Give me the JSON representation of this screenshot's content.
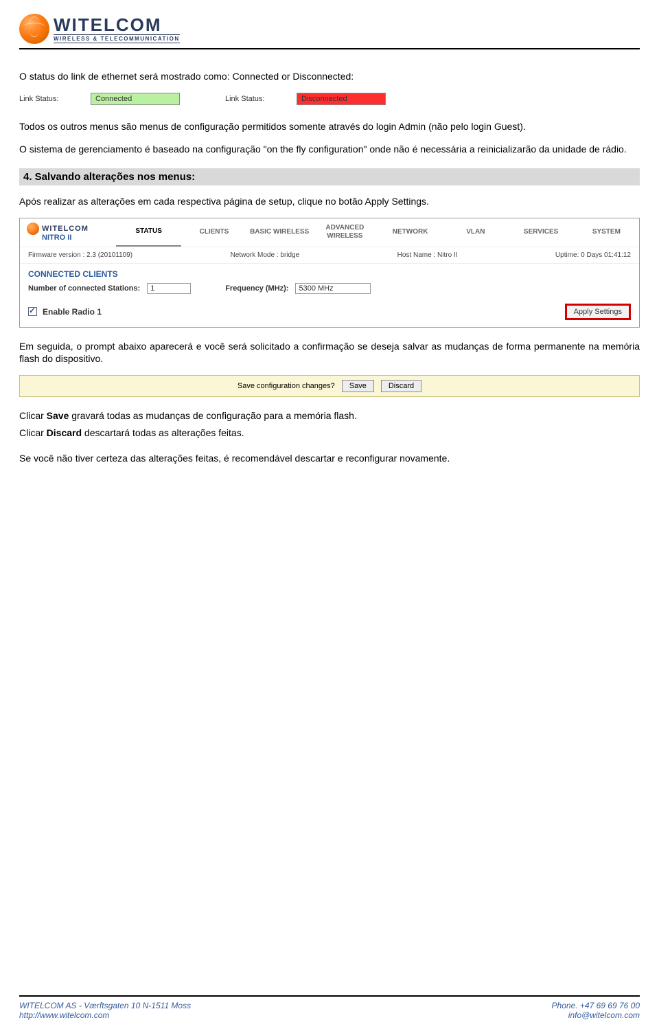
{
  "header": {
    "brand_main": "WITELCOM",
    "brand_sub": "WIRELESS & TELECOMMUNICATION"
  },
  "p1": "O status do link de ethernet será mostrado como: Connected or Disconnected:",
  "linkstatus": {
    "label1": "Link Status:",
    "val1": "Connected",
    "label2": "Link Status:",
    "val2": "Disconnected"
  },
  "p2": "Todos os outros menus são menus de configuração permitidos somente através do login Admin (não pelo login Guest).",
  "p3": "O sistema de gerenciamento é baseado na configuração \"on the fly configuration\" onde não é necessária a reinicializarão da unidade de rádio.",
  "section4": "4. Salvando alterações nos menus:",
  "p4": "Após realizar as alterações em cada respectiva página de setup, clique no botão Apply Settings.",
  "admin": {
    "brand": "WITELCOM",
    "model": "NITRO II",
    "tabs": [
      "STATUS",
      "CLIENTS",
      "BASIC WIRELESS",
      "ADVANCED WIRELESS",
      "NETWORK",
      "VLAN",
      "SERVICES",
      "SYSTEM"
    ],
    "active_tab": "STATUS",
    "info": {
      "fw_label": "Firmware version :",
      "fw_value": "2.3 (20101109)",
      "mode_label": "Network Mode :",
      "mode_value": "bridge",
      "host_label": "Host Name :",
      "host_value": "Nitro II",
      "uptime_label": "Uptime:",
      "uptime_value": "0 Days 01:41:12"
    },
    "cc_title": "CONNECTED CLIENTS",
    "cc_stations_label": "Number of connected Stations:",
    "cc_stations_value": "1",
    "cc_freq_label": "Frequency (MHz):",
    "cc_freq_value": "5300 MHz",
    "enable_label": "Enable Radio 1",
    "apply_label": "Apply Settings"
  },
  "p5": "Em seguida, o prompt abaixo aparecerá e você será solicitado a confirmação se deseja salvar as mudanças de forma permanente na memória flash do dispositivo.",
  "savebar": {
    "question": "Save configuration changes?",
    "save": "Save",
    "discard": "Discard"
  },
  "p6_prefix": "Clicar ",
  "p6_bold": "Save",
  "p6_suffix": " gravará todas as mudanças de configuração para a memória flash.",
  "p7_prefix": "Clicar ",
  "p7_bold": "Discard",
  "p7_suffix": " descartará todas as alterações feitas.",
  "p8": "Se você não tiver certeza das alterações feitas, é recomendável descartar e reconfigurar novamente.",
  "footer": {
    "left_line1": "WITELCOM AS - Værftsgaten 10 N-1511 Moss",
    "left_line2": "http://www.witelcom.com",
    "right_line1": "Phone. +47 69 69 76 00",
    "right_line2": "info@witelcom.com"
  }
}
